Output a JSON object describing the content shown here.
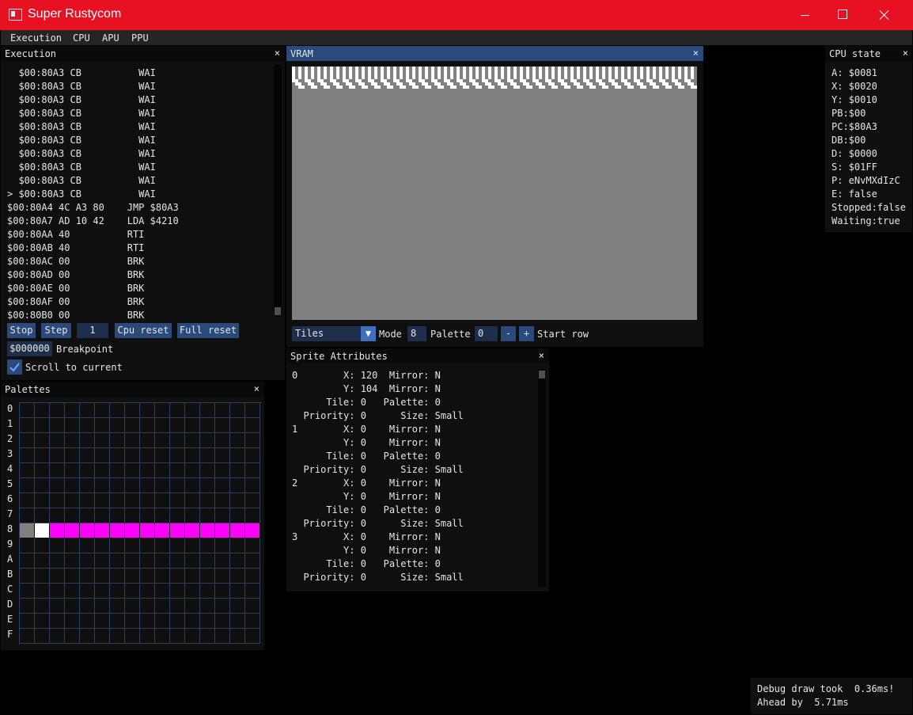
{
  "window": {
    "title": "Super Rustycom",
    "minimize": "—",
    "maximize": "☐",
    "close": "✕"
  },
  "menu": [
    "Execution",
    "CPU",
    "APU",
    "PPU"
  ],
  "execution": {
    "title": "Execution",
    "close": "×",
    "lines": [
      "  $00:80A3 CB          WAI",
      "  $00:80A3 CB          WAI",
      "  $00:80A3 CB          WAI",
      "  $00:80A3 CB          WAI",
      "  $00:80A3 CB          WAI",
      "  $00:80A3 CB          WAI",
      "  $00:80A3 CB          WAI",
      "  $00:80A3 CB          WAI",
      "  $00:80A3 CB          WAI",
      "> $00:80A3 CB          WAI",
      "$00:80A4 4C A3 80    JMP $80A3",
      "$00:80A7 AD 10 42    LDA $4210",
      "$00:80AA 40          RTI",
      "$00:80AB 40          RTI",
      "$00:80AC 00          BRK",
      "$00:80AD 00          BRK",
      "$00:80AE 00          BRK",
      "$00:80AF 00          BRK",
      "$00:80B0 00          BRK"
    ],
    "buttons": {
      "stop": "Stop",
      "step": "Step",
      "step_count": "1",
      "cpu_reset": "Cpu reset",
      "full_reset": "Full reset"
    },
    "breakpoint_value": "$000000",
    "breakpoint_label": "Breakpoint",
    "scroll_label": "Scroll to current",
    "scroll_checked": true
  },
  "vram": {
    "title": "VRAM",
    "close": "×",
    "mode_select": "Tiles",
    "mode_label": "Mode",
    "mode_value": "8",
    "palette_label": "Palette",
    "palette_value": "0",
    "minus": "-",
    "plus": "+",
    "start_row_label": "Start row"
  },
  "cpu_state": {
    "title": "CPU state",
    "close": "×",
    "lines": [
      "A: $0081",
      "X: $0020",
      "Y: $0010",
      "PB:$00",
      "PC:$80A3",
      "DB:$00",
      "D: $0000",
      "S: $01FF",
      "P: eNvMXdIzC",
      "E: false",
      "Stopped:false",
      "Waiting:true"
    ]
  },
  "palettes": {
    "title": "Palettes",
    "close": "×",
    "rows": [
      "0",
      "1",
      "2",
      "3",
      "4",
      "5",
      "6",
      "7",
      "8",
      "9",
      "A",
      "B",
      "C",
      "D",
      "E",
      "F"
    ],
    "row8_colors": [
      "#808080",
      "#ffffff",
      "#ff00ff",
      "#ff00ff",
      "#ff00ff",
      "#ff00ff",
      "#ff00ff",
      "#ff00ff",
      "#ff00ff",
      "#ff00ff",
      "#ff00ff",
      "#ff00ff",
      "#ff00ff",
      "#ff00ff",
      "#ff00ff",
      "#ff00ff"
    ]
  },
  "sprites": {
    "title": "Sprite Attributes",
    "close": "×",
    "lines": [
      "0        X: 120  Mirror: N",
      "         Y: 104  Mirror: N",
      "      Tile: 0   Palette: 0",
      "  Priority: 0      Size: Small",
      "1        X: 0    Mirror: N",
      "         Y: 0    Mirror: N",
      "      Tile: 0   Palette: 0",
      "  Priority: 0      Size: Small",
      "2        X: 0    Mirror: N",
      "         Y: 0    Mirror: N",
      "      Tile: 0   Palette: 0",
      "  Priority: 0      Size: Small",
      "3        X: 0    Mirror: N",
      "         Y: 0    Mirror: N",
      "      Tile: 0   Palette: 0",
      "  Priority: 0      Size: Small"
    ]
  },
  "debug": {
    "line1": "Debug draw took  0.36ms!",
    "line2": "Ahead by  5.71ms"
  },
  "colors": {
    "title_bar": "#e81123",
    "active_header": "#294a7a",
    "button": "#294a7a",
    "vram_bg": "#808080",
    "magenta": "#ff00ff"
  }
}
